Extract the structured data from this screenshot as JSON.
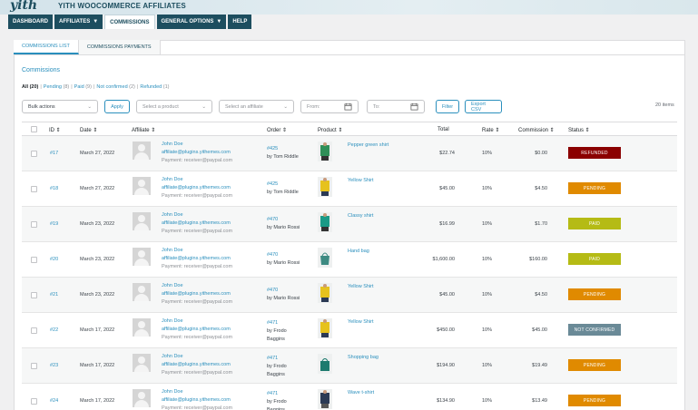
{
  "header": {
    "logo": "yith",
    "brand": "YITH WOOCOMMERCE AFFILIATES"
  },
  "nav": [
    {
      "label": "DASHBOARD",
      "chevron": false,
      "active": false
    },
    {
      "label": "AFFILIATES",
      "chevron": true,
      "active": false
    },
    {
      "label": "COMMISSIONS",
      "chevron": false,
      "active": true
    },
    {
      "label": "GENERAL OPTIONS",
      "chevron": true,
      "active": false
    },
    {
      "label": "HELP",
      "chevron": false,
      "active": false
    }
  ],
  "subtabs": [
    {
      "label": "COMMISSIONS LIST",
      "active": true
    },
    {
      "label": "COMMISSIONS PAYMENTS",
      "active": false
    }
  ],
  "section_title": "Commissions",
  "status_filters": [
    {
      "label": "All",
      "count": "(20)"
    },
    {
      "label": "Pending",
      "count": "(8)"
    },
    {
      "label": "Paid",
      "count": "(9)"
    },
    {
      "label": "Not confirmed",
      "count": "(2)"
    },
    {
      "label": "Refunded",
      "count": "(1)"
    }
  ],
  "toolbar": {
    "bulk_actions": "Bulk actions",
    "apply": "Apply",
    "product_placeholder": "Select a product",
    "affiliate_placeholder": "Select an affiliate",
    "from_placeholder": "From:",
    "to_placeholder": "To:",
    "filter": "Filter",
    "export": "Export CSV",
    "items_count": "20 items"
  },
  "columns": [
    "ID",
    "Date",
    "Affiliate",
    "Order",
    "Product",
    "Total",
    "Rate",
    "Commission",
    "Status"
  ],
  "status_colors": {
    "REFUNDED": "#8b0000",
    "PENDING": "#e08a00",
    "PAID": "#b5bb15",
    "NOT CONFIRMED": "#6a8a97"
  },
  "rows": [
    {
      "id": "#17",
      "date": "March 27, 2022",
      "aff_name": "John Doe",
      "aff_email": "affiliate@plugins.yithemes.com",
      "aff_payment": "Payment: receiver@paypal.com",
      "order_id": "#425",
      "order_by": "by Tom Riddle",
      "order_by2": "",
      "product": "Pepper green shirt",
      "product_icon": "green-shirt-icon",
      "total": "$22.74",
      "rate": "10%",
      "commission": "$0.00",
      "status": "REFUNDED"
    },
    {
      "id": "#18",
      "date": "March 27, 2022",
      "aff_name": "John Doe",
      "aff_email": "affiliate@plugins.yithemes.com",
      "aff_payment": "Payment: receiver@paypal.com",
      "order_id": "#425",
      "order_by": "by Tom Riddle",
      "order_by2": "",
      "product": "Yellow Shirt",
      "product_icon": "yellow-shirt-icon",
      "total": "$45.00",
      "rate": "10%",
      "commission": "$4.50",
      "status": "PENDING"
    },
    {
      "id": "#19",
      "date": "March 23, 2022",
      "aff_name": "John Doe",
      "aff_email": "affiliate@plugins.yithemes.com",
      "aff_payment": "Payment: receiver@paypal.com",
      "order_id": "#470",
      "order_by": "by Mario Rossi",
      "order_by2": "",
      "product": "Classy shirt",
      "product_icon": "teal-shirt-icon",
      "total": "$16.99",
      "rate": "10%",
      "commission": "$1.70",
      "status": "PAID"
    },
    {
      "id": "#20",
      "date": "March 23, 2022",
      "aff_name": "John Doe",
      "aff_email": "affiliate@plugins.yithemes.com",
      "aff_payment": "Payment: receiver@paypal.com",
      "order_id": "#470",
      "order_by": "by Mario Rossi",
      "order_by2": "",
      "product": "Hand bag",
      "product_icon": "handbag-icon",
      "total": "$1,600.00",
      "rate": "10%",
      "commission": "$160.00",
      "status": "PAID"
    },
    {
      "id": "#21",
      "date": "March 23, 2022",
      "aff_name": "John Doe",
      "aff_email": "affiliate@plugins.yithemes.com",
      "aff_payment": "Payment: receiver@paypal.com",
      "order_id": "#470",
      "order_by": "by Mario Rossi",
      "order_by2": "",
      "product": "Yellow Shirt",
      "product_icon": "yellow-shirt-icon",
      "total": "$45.00",
      "rate": "10%",
      "commission": "$4.50",
      "status": "PENDING"
    },
    {
      "id": "#22",
      "date": "March 17, 2022",
      "aff_name": "John Doe",
      "aff_email": "affiliate@plugins.yithemes.com",
      "aff_payment": "Payment: receiver@paypal.com",
      "order_id": "#471",
      "order_by": "by Frodo",
      "order_by2": "Baggins",
      "product": "Yellow Shirt",
      "product_icon": "yellow-shirt-icon",
      "total": "$450.00",
      "rate": "10%",
      "commission": "$45.00",
      "status": "NOT CONFIRMED"
    },
    {
      "id": "#23",
      "date": "March 17, 2022",
      "aff_name": "John Doe",
      "aff_email": "affiliate@plugins.yithemes.com",
      "aff_payment": "Payment: receiver@paypal.com",
      "order_id": "#471",
      "order_by": "by Frodo",
      "order_by2": "Baggins",
      "product": "Shopping bag",
      "product_icon": "shopping-bag-icon",
      "total": "$194.90",
      "rate": "10%",
      "commission": "$19.49",
      "status": "PENDING"
    },
    {
      "id": "#24",
      "date": "March 17, 2022",
      "aff_name": "John Doe",
      "aff_email": "affiliate@plugins.yithemes.com",
      "aff_payment": "Payment: receiver@paypal.com",
      "order_id": "#471",
      "order_by": "by Frodo",
      "order_by2": "Baggins",
      "product": "Wave t-shirt",
      "product_icon": "navy-tshirt-icon",
      "total": "$134.90",
      "rate": "10%",
      "commission": "$13.49",
      "status": "PENDING"
    }
  ]
}
